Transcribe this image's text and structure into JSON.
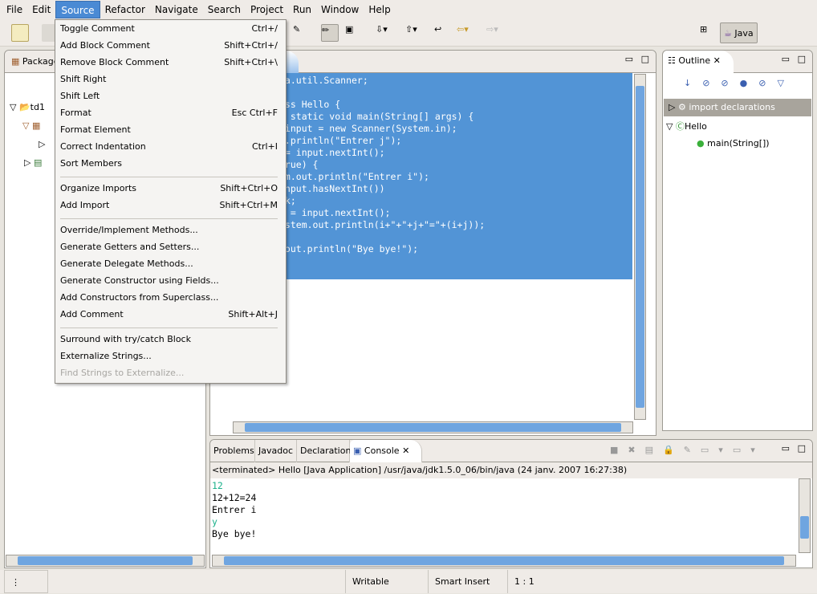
{
  "menubar": [
    "File",
    "Edit",
    "Source",
    "Refactor",
    "Navigate",
    "Search",
    "Project",
    "Run",
    "Window",
    "Help"
  ],
  "active_menu": "Source",
  "perspective": {
    "label": "Java"
  },
  "package_explorer": {
    "title": "Package",
    "tree": [
      "td1"
    ]
  },
  "editor": {
    "code_lines": [
      "va.util.Scanner;",
      "",
      "ass Hello {",
      "c static void main(String[] args) {",
      " input = new Scanner(System.in);",
      "t.println(\"Entrer j\");",
      " = input.nextInt();",
      "true) {",
      "em.out.println(\"Entrer i\");",
      "input.hasNextInt())",
      "ak;",
      "i = input.nextInt();",
      "ystem.out.println(i+\"+\"+j+\"=\"+(i+j));",
      "",
      ".out.println(\"Bye bye!\");"
    ],
    "selection_color": "#5294d6"
  },
  "source_menu": [
    {
      "label": "Toggle Comment",
      "shortcut": "Ctrl+/"
    },
    {
      "label": "Add Block Comment",
      "shortcut": "Shift+Ctrl+/"
    },
    {
      "label": "Remove Block Comment",
      "shortcut": "Shift+Ctrl+\\"
    },
    {
      "label": "Shift Right",
      "shortcut": ""
    },
    {
      "label": "Shift Left",
      "shortcut": ""
    },
    {
      "label": "Format",
      "shortcut": "Esc Ctrl+F"
    },
    {
      "label": "Format Element",
      "shortcut": ""
    },
    {
      "label": "Correct Indentation",
      "shortcut": "Ctrl+I"
    },
    {
      "label": "Sort Members",
      "shortcut": ""
    },
    {
      "label": "Organize Imports",
      "shortcut": "Shift+Ctrl+O"
    },
    {
      "label": "Add Import",
      "shortcut": "Shift+Ctrl+M"
    },
    {
      "label": "Override/Implement Methods...",
      "shortcut": ""
    },
    {
      "label": "Generate Getters and Setters...",
      "shortcut": ""
    },
    {
      "label": "Generate Delegate Methods...",
      "shortcut": ""
    },
    {
      "label": "Generate Constructor using Fields...",
      "shortcut": ""
    },
    {
      "label": "Add Constructors from Superclass...",
      "shortcut": ""
    },
    {
      "label": "Add Comment",
      "shortcut": "Shift+Alt+J"
    },
    {
      "label": "Surround with try/catch Block",
      "shortcut": ""
    },
    {
      "label": "Externalize Strings...",
      "shortcut": ""
    },
    {
      "label": "Find Strings to Externalize...",
      "shortcut": "",
      "disabled": true
    }
  ],
  "outline": {
    "title": "Outline",
    "items": [
      "import declarations",
      "Hello",
      "main(String[])"
    ]
  },
  "console": {
    "tabs": [
      "Problems",
      "Javadoc",
      "Declaration",
      "Console"
    ],
    "header": "<terminated> Hello [Java Application] /usr/java/jdk1.5.0_06/bin/java (24 janv. 2007 16:27:38)",
    "lines": [
      {
        "text": "12",
        "input": true
      },
      {
        "text": "12+12=24"
      },
      {
        "text": "Entrer i"
      },
      {
        "text": "y",
        "input": true
      },
      {
        "text": "Bye bye!"
      }
    ]
  },
  "statusbar": {
    "mode": "Writable",
    "insert": "Smart Insert",
    "position": "1 : 1"
  }
}
